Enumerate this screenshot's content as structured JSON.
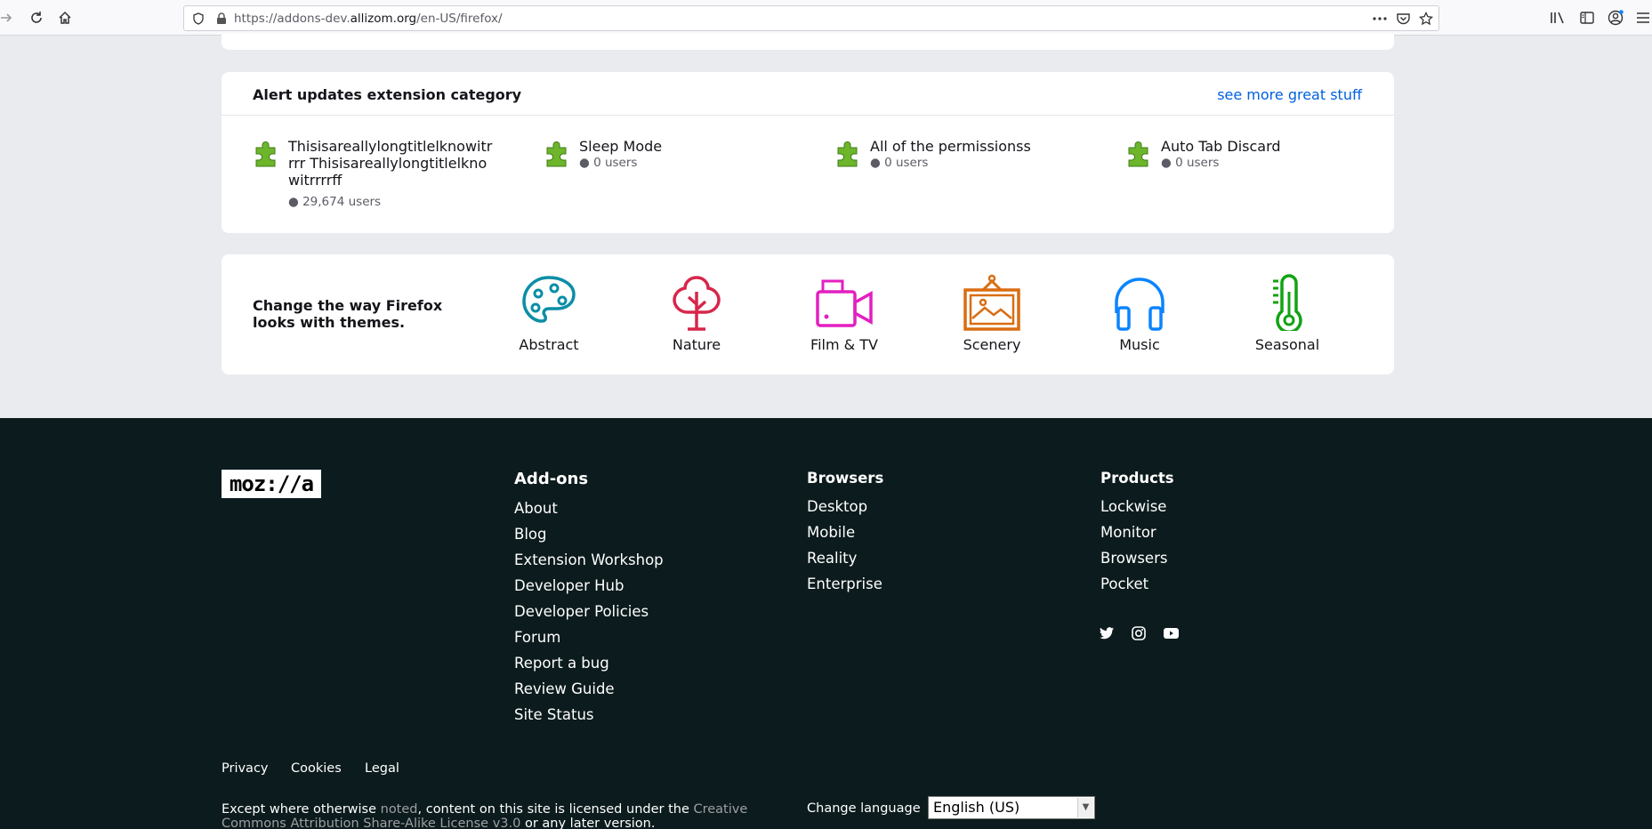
{
  "browser": {
    "url_prefix": "https://addons-dev.",
    "url_domain": "allizom.org",
    "url_suffix": "/en-US/firefox/"
  },
  "alert_card": {
    "title": "Alert updates extension category",
    "link": "see more great stuff",
    "addons": [
      {
        "name": "Thisisareallylongtitlelknowitrrrr Thisisareallylongtitlelknowitrrrrff",
        "users": "29,674 users"
      },
      {
        "name": "Sleep Mode",
        "users": "0 users"
      },
      {
        "name": "All of the permissionss",
        "users": "0 users"
      },
      {
        "name": "Auto Tab Discard",
        "users": "0 users"
      }
    ]
  },
  "themes_card": {
    "title": "Change the way Firefox looks with themes.",
    "themes": [
      {
        "label": "Abstract",
        "color": "#0b8ea6"
      },
      {
        "label": "Nature",
        "color": "#d7264a"
      },
      {
        "label": "Film & TV",
        "color": "#e31fc0"
      },
      {
        "label": "Scenery",
        "color": "#d96d12"
      },
      {
        "label": "Music",
        "color": "#0a84ff"
      },
      {
        "label": "Seasonal",
        "color": "#12a312"
      }
    ]
  },
  "footer": {
    "logo": "moz://a",
    "addons": {
      "heading": "Add-ons",
      "links": [
        "About",
        "Blog",
        "Extension Workshop",
        "Developer Hub",
        "Developer Policies",
        "Forum",
        "Report a bug",
        "Review Guide",
        "Site Status"
      ]
    },
    "browsers": {
      "heading": "Browsers",
      "links": [
        "Desktop",
        "Mobile",
        "Reality",
        "Enterprise"
      ]
    },
    "products": {
      "heading": "Products",
      "links": [
        "Lockwise",
        "Monitor",
        "Browsers",
        "Pocket"
      ]
    },
    "legal_links": [
      "Privacy",
      "Cookies",
      "Legal"
    ],
    "license": {
      "part1": "Except where otherwise ",
      "noted": "noted",
      "part2": ", content on this site is licensed under the ",
      "cc": "Creative Commons Attribution Share-Alike License v3.0",
      "part3": " or any later version."
    },
    "language_label": "Change language",
    "language_selected": "English (US)"
  }
}
